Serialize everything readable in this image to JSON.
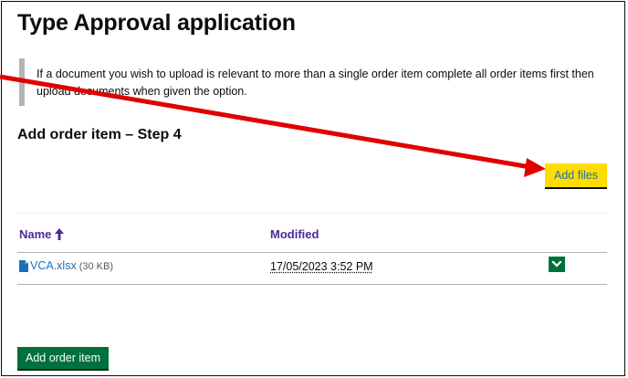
{
  "page": {
    "title": "Type Approval application"
  },
  "inset": {
    "text": "If a document you wish to upload is relevant to more than a single order item complete all order items first then upload documents when given the option."
  },
  "step": {
    "heading": "Add order item – Step 4"
  },
  "buttons": {
    "add_files": "Add files",
    "add_order_item": "Add order item"
  },
  "table": {
    "columns": {
      "name": "Name",
      "modified": "Modified"
    },
    "sort": {
      "column": "Name",
      "direction": "ascending"
    },
    "rows": [
      {
        "file_name": "VCA.xlsx",
        "size": "(30 KB)",
        "modified": "17/05/2023 3:52 PM"
      }
    ]
  },
  "icons": {
    "sort": "arrow-up-icon",
    "file": "file-icon",
    "row_menu": "chevron-down-icon"
  },
  "colors": {
    "primary_button": "#00703c",
    "add_files_button": "#ffdd00",
    "link": "#1d70b8",
    "column_header": "#4c2c92",
    "annotation_arrow": "#e00000"
  }
}
